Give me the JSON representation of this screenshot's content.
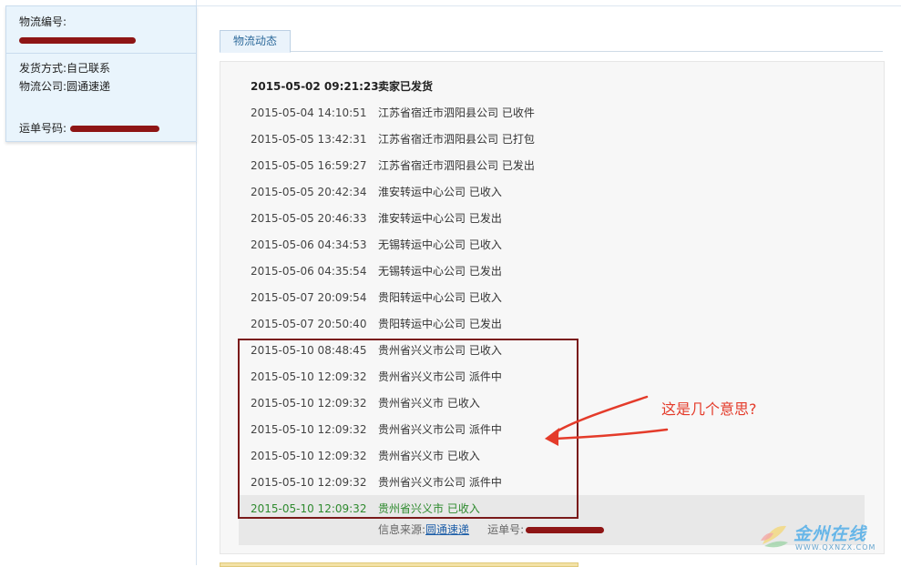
{
  "info": {
    "tracking_label": "物流编号:",
    "ship_method_label": "发货方式:",
    "ship_method_value": "自己联系",
    "carrier_label": "物流公司:",
    "carrier_value": "圆通速递",
    "waybill_label": "运单号码:"
  },
  "tab": {
    "label": "物流动态"
  },
  "events": [
    {
      "time": "2015-05-02 09:21:23",
      "desc": "卖家已发货"
    },
    {
      "time": "2015-05-04 14:10:51",
      "desc": "江苏省宿迁市泗阳县公司 已收件"
    },
    {
      "time": "2015-05-05 13:42:31",
      "desc": "江苏省宿迁市泗阳县公司 已打包"
    },
    {
      "time": "2015-05-05 16:59:27",
      "desc": "江苏省宿迁市泗阳县公司 已发出"
    },
    {
      "time": "2015-05-05 20:42:34",
      "desc": "淮安转运中心公司 已收入"
    },
    {
      "time": "2015-05-05 20:46:33",
      "desc": "淮安转运中心公司 已发出"
    },
    {
      "time": "2015-05-06 04:34:53",
      "desc": "无锡转运中心公司 已收入"
    },
    {
      "time": "2015-05-06 04:35:54",
      "desc": "无锡转运中心公司 已发出"
    },
    {
      "time": "2015-05-07 20:09:54",
      "desc": "贵阳转运中心公司 已收入"
    },
    {
      "time": "2015-05-07 20:50:40",
      "desc": "贵阳转运中心公司 已发出"
    },
    {
      "time": "2015-05-10 08:48:45",
      "desc": "贵州省兴义市公司 已收入"
    },
    {
      "time": "2015-05-10 12:09:32",
      "desc": "贵州省兴义市公司 派件中"
    },
    {
      "time": "2015-05-10 12:09:32",
      "desc": "贵州省兴义市 已收入"
    },
    {
      "time": "2015-05-10 12:09:32",
      "desc": "贵州省兴义市公司 派件中"
    },
    {
      "time": "2015-05-10 12:09:32",
      "desc": "贵州省兴义市 已收入"
    },
    {
      "time": "2015-05-10 12:09:32",
      "desc": "贵州省兴义市公司 派件中"
    },
    {
      "time": "2015-05-10 12:09:32",
      "desc": "贵州省兴义市 已收入"
    }
  ],
  "source": {
    "label": "信息来源:",
    "link": "圆通速递",
    "waybill_label": "运单号:"
  },
  "annotation": {
    "text": "这是几个意思?"
  },
  "watermark": {
    "title": "金州在线",
    "url": "WWW.QXNZX.COM"
  },
  "colors": {
    "latest_event": "#2e8a2e",
    "annotation": "#e43b2a",
    "highlight_box": "#7a1a1a",
    "link": "#1f5fa8"
  }
}
